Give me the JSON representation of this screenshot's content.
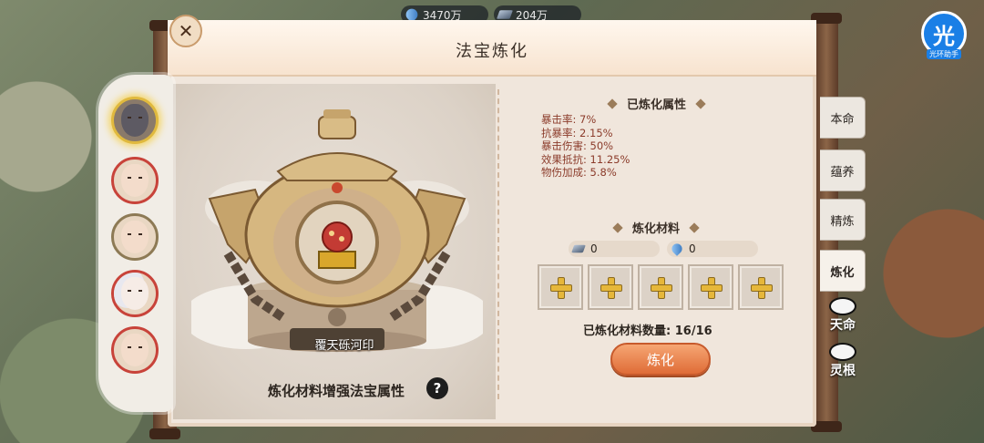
{
  "currency": {
    "gem": "3470万",
    "ingot": "204万"
  },
  "assistant": {
    "char": "光",
    "label": "光环助手"
  },
  "panel": {
    "title": "法宝炼化",
    "close_icon_char": "✕"
  },
  "treasure": {
    "name": "覆天砾河印",
    "hint": "炼化材料增强法宝属性",
    "help": "?"
  },
  "refined_attributes": {
    "title": "已炼化属性",
    "items": [
      "暴击率:  7%",
      "抗暴率:  2.15%",
      "暴击伤害:  50%",
      "效果抵抗:  11.25%",
      "物伤加成:  5.8%"
    ]
  },
  "materials": {
    "title": "炼化材料",
    "ingot_count": "0",
    "gem_count": "0",
    "slot_count": 5,
    "refined_count_label": "已炼化材料数量: 16/16",
    "refine_button": "炼化"
  },
  "tabs": [
    {
      "label": "本命"
    },
    {
      "label": "蕴养"
    },
    {
      "label": "精炼"
    },
    {
      "label": "炼化"
    },
    {
      "label": "天命"
    },
    {
      "label": "灵根"
    }
  ],
  "colors": {
    "accent_orange": "#df6c37",
    "attribute_text": "#8b3b2a",
    "hero_border_red": "#c8433a",
    "hero_selected_gold": "#e0b93e"
  }
}
